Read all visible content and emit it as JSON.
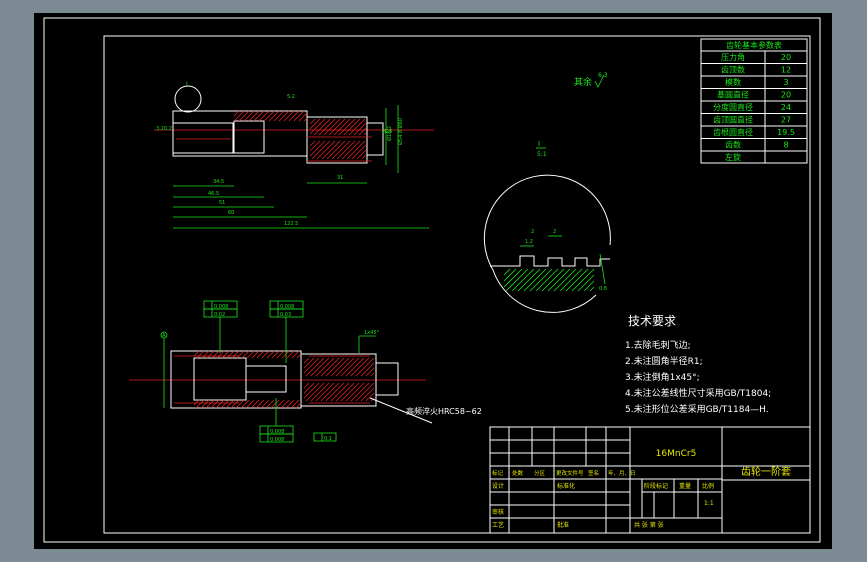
{
  "params_table": {
    "title": "齿轮基本参数表",
    "rows": [
      {
        "label": "压力角",
        "value": "20"
      },
      {
        "label": "齿顶数",
        "value": "12"
      },
      {
        "label": "模数",
        "value": "3"
      },
      {
        "label": "基圆直径",
        "value": "20"
      },
      {
        "label": "分度圆直径",
        "value": "24"
      },
      {
        "label": "齿顶圆直径",
        "value": "27"
      },
      {
        "label": "齿根圆直径",
        "value": "19.5"
      },
      {
        "label": "齿数",
        "value": "8"
      },
      {
        "label": "左旋",
        "value": ""
      }
    ]
  },
  "roughness_note": "其余",
  "roughness_value": "6.3",
  "detail_label": "I",
  "detail_scale": "5:1",
  "tech_title": "技术要求",
  "tech_items": [
    "1.去除毛刺飞边;",
    "2.未注圆角半径R1;",
    "3.未注倒角1x45°;",
    "4.未注公差线性尺寸采用GB/T1804;",
    "5.未注形位公差采用GB/T1184—H."
  ],
  "heat_treatment": "高频淬火HRC58~62",
  "material": "16MnCr5",
  "part_name": "齿轮一阶套",
  "title_block": {
    "header_labels": [
      "标记",
      "处数",
      "分区",
      "更改文件号",
      "签名",
      "年、月、日"
    ],
    "design": "设计",
    "standardize": "标准化",
    "review": "审核",
    "process": "工艺",
    "approve": "批准",
    "stage_mark": "阶段标记",
    "weight": "重量",
    "scale": "比例",
    "scale_value": "1:1",
    "sheets": "共    张    第    张"
  },
  "dims_top": {
    "d1": "3.2",
    "d2": "5.2",
    "d3": "Ø16.2",
    "d4": "Ø54.8 Ø60",
    "l1": "34.5",
    "l2": "46.5",
    "l3": "51",
    "l4": "60",
    "l5": "122.5",
    "l6": "31",
    "tol": "0.2",
    "lbl_i": "I",
    "lbl_d": "Ø25"
  },
  "dims_bottom": {
    "tol1": "0.008",
    "tol2": "0.02",
    "tol3": "0.008",
    "tol4": "0.03",
    "tol5": "0.008",
    "tol6": "0.008",
    "tol7": "0.008",
    "tol8": "0.1",
    "chamfer": "1x45°",
    "letter_a": "A",
    "letter_b": "B"
  },
  "detail_dims": {
    "w1": "2",
    "w2": "1.2",
    "w3": "2",
    "d": "0.8"
  }
}
